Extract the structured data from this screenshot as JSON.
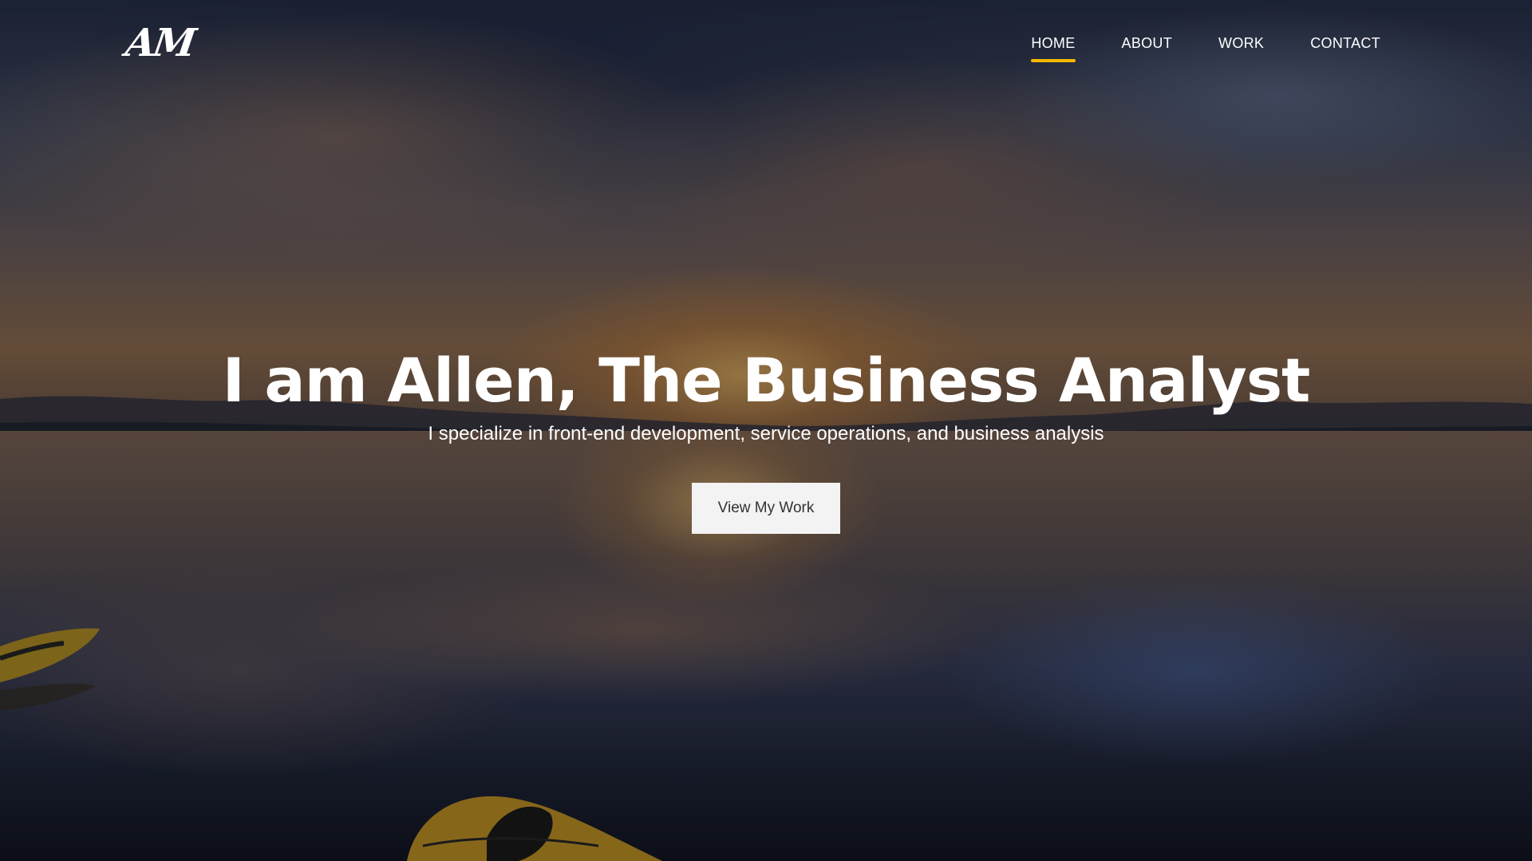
{
  "header": {
    "logo_text": "AM",
    "nav": [
      {
        "label": "HOME",
        "active": true
      },
      {
        "label": "ABOUT",
        "active": false
      },
      {
        "label": "WORK",
        "active": false
      },
      {
        "label": "CONTACT",
        "active": false
      }
    ],
    "active_underline_color": "#f5b800"
  },
  "hero": {
    "title": "I am Allen, The Business Analyst",
    "subtitle": "I specialize in front-end development, service operations, and business analysis",
    "cta_label": "View My Work"
  }
}
